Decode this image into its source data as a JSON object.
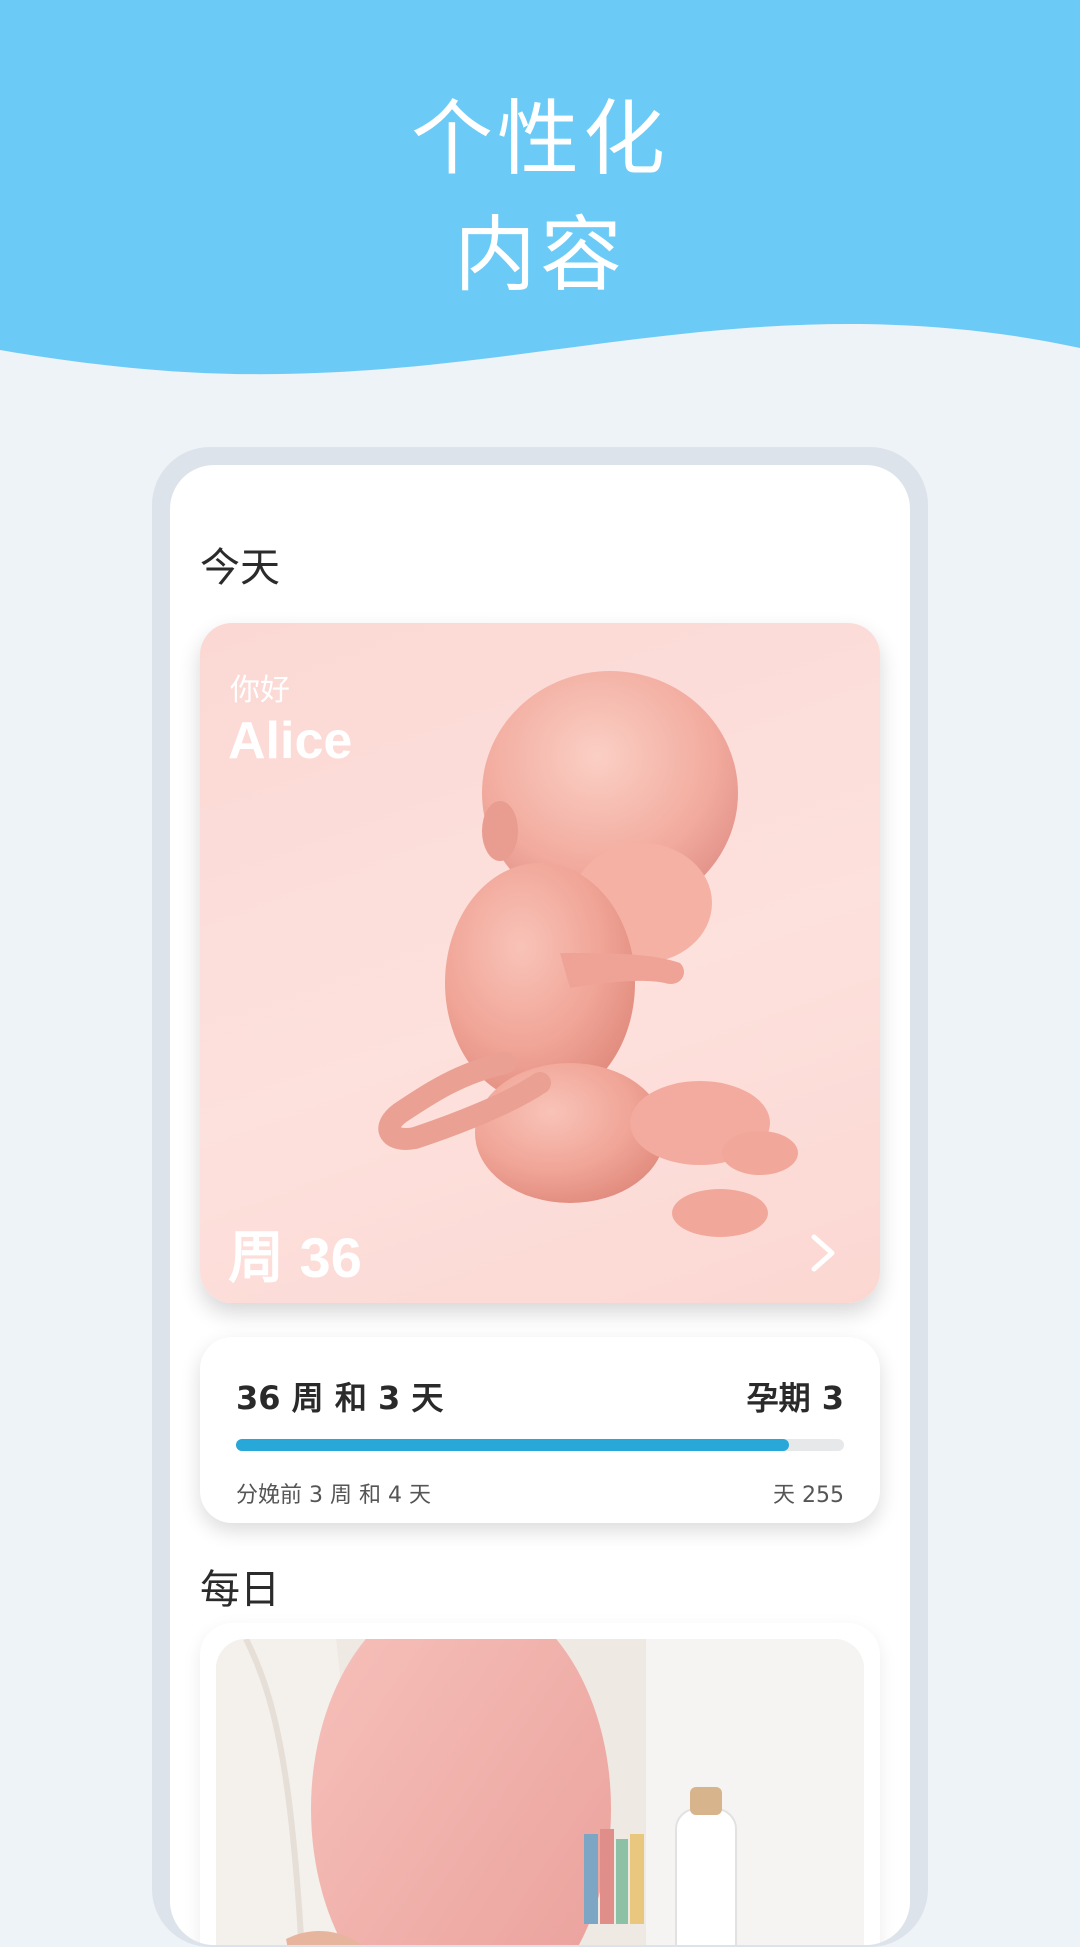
{
  "hero": {
    "title_line1": "个性化",
    "title_line2": "内容",
    "background_color": "#6ccbf6"
  },
  "today": {
    "section_title": "今天",
    "greeting": "你好",
    "user_name": "Alice",
    "week_label": "周 36",
    "card_color": "#fcdcd8"
  },
  "progress": {
    "summary": "36 周 和 3 天",
    "trimester": "孕期 3",
    "remaining": "分娩前 3 周 和 4 天",
    "day_count": "天 255",
    "fraction": 0.91,
    "bar_color": "#27a8d8"
  },
  "daily": {
    "section_title": "每日",
    "image": "pregnant-woman-photo"
  }
}
